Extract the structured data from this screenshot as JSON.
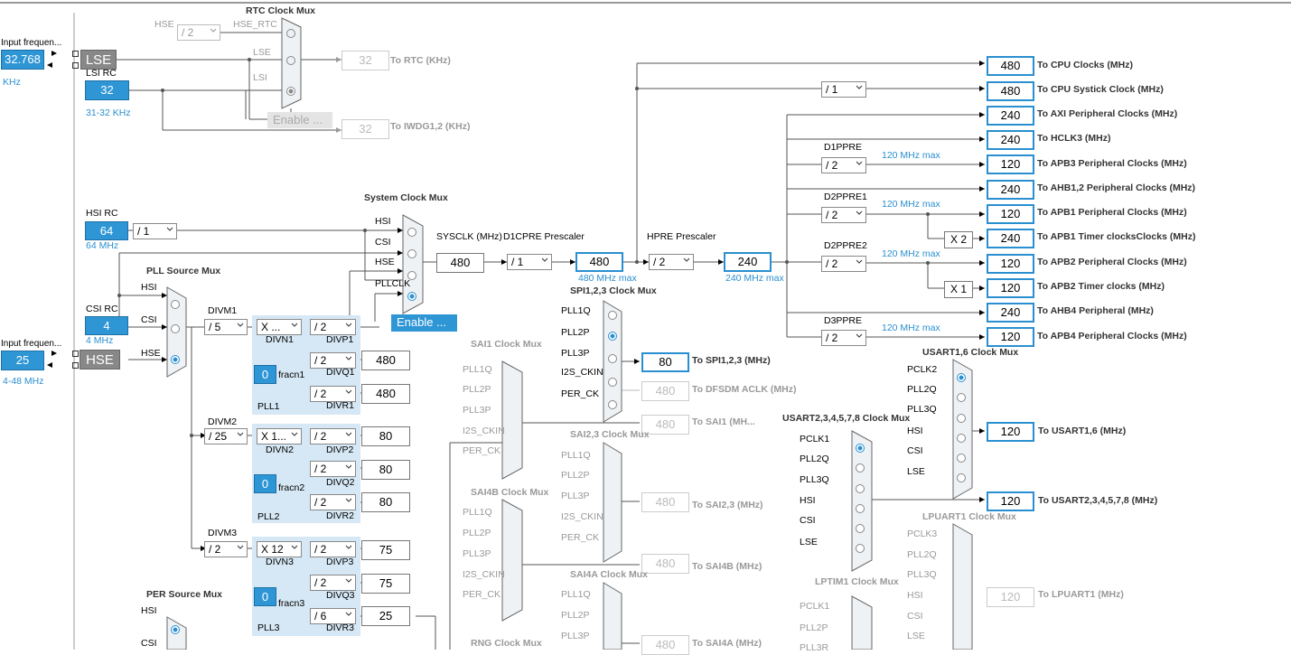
{
  "rtc": {
    "title": "RTC Clock Mux",
    "hse_label": "HSE",
    "hse_rtc_label": "HSE_RTC",
    "hse_div": "/ 2",
    "in_lse": "LSE",
    "in_lsi": "LSI",
    "out_value": "32",
    "out_label": "To RTC (KHz)",
    "enable": "Enable ...",
    "iwdg_value": "32",
    "iwdg_label": "To IWDG1,2 (KHz)"
  },
  "lse": {
    "input_label": "Input frequen...",
    "value": "32.768",
    "unit": "KHz",
    "name": "LSE"
  },
  "lsi": {
    "name": "LSI RC",
    "value": "32",
    "range": "31-32 KHz"
  },
  "hsi": {
    "name": "HSI RC",
    "value": "64",
    "freq": "64 MHz",
    "div": "/ 1"
  },
  "csi": {
    "name": "CSI RC",
    "value": "4",
    "freq": "4 MHz"
  },
  "hse": {
    "input_label": "Input frequen...",
    "value": "25",
    "range": "4-48 MHz",
    "name": "HSE"
  },
  "sysmux": {
    "title": "System Clock Mux",
    "inputs": [
      "HSI",
      "CSI",
      "HSE",
      "PLLCLK"
    ],
    "enable": "Enable ...",
    "sysclk_label": "SYSCLK (MHz)",
    "sysclk_value": "480",
    "d1cpre_label": "D1CPRE Prescaler",
    "d1cpre_div": "/ 1",
    "d1cpre_out": "480",
    "d1cpre_max": "480 MHz max",
    "hpre_label": "HPRE Prescaler",
    "hpre_div": "/ 2",
    "hpre_out": "240",
    "hpre_max": "240 MHz max",
    "systick_div": "/ 1"
  },
  "pll_src": {
    "title": "PLL Source Mux",
    "inputs": [
      "HSI",
      "CSI",
      "HSE"
    ]
  },
  "pll1": {
    "divm_label": "DIVM1",
    "divm": "/ 5",
    "divn": "X ...",
    "divn_label": "DIVN1",
    "divp": "/ 2",
    "divp_label": "DIVP1",
    "divq": "/ 2",
    "divq_label": "DIVQ1",
    "divq_out": "480",
    "divr": "/ 2",
    "divr_label": "DIVR1",
    "divr_out": "480",
    "frac": "0",
    "frac_label": "fracn1",
    "name": "PLL1"
  },
  "pll2": {
    "divm_label": "DIVM2",
    "divm": "/ 25",
    "divn": "X 1...",
    "divn_label": "DIVN2",
    "divp": "/ 2",
    "divp_label": "DIVP2",
    "divp_out": "80",
    "divq": "/ 2",
    "divq_label": "DIVQ2",
    "divq_out": "80",
    "divr": "/ 2",
    "divr_label": "DIVR2",
    "divr_out": "80",
    "frac": "0",
    "frac_label": "fracn2",
    "name": "PLL2"
  },
  "pll3": {
    "divm_label": "DIVM3",
    "divm": "/ 2",
    "divn": "X 12",
    "divn_label": "DIVN3",
    "divp": "/ 2",
    "divp_label": "DIVP3",
    "divp_out": "75",
    "divq": "/ 2",
    "divq_label": "DIVQ3",
    "divq_out": "75",
    "divr": "/ 6",
    "divr_label": "DIVR3",
    "divr_out": "25",
    "frac": "0",
    "frac_label": "fracn3",
    "name": "PLL3"
  },
  "per_src": {
    "title": "PER Source Mux",
    "inputs": [
      "HSI",
      "CSI"
    ]
  },
  "outputs": [
    {
      "value": "480",
      "label": "To CPU Clocks (MHz)"
    },
    {
      "value": "480",
      "label": "To CPU Systick Clock (MHz)"
    },
    {
      "value": "240",
      "label": "To AXI Peripheral Clocks (MHz)"
    },
    {
      "value": "240",
      "label": "To HCLK3 (MHz)"
    },
    {
      "value": "120",
      "label": "To APB3 Peripheral Clocks (MHz)"
    },
    {
      "value": "240",
      "label": "To AHB1,2 Peripheral Clocks (MHz)"
    },
    {
      "value": "120",
      "label": "To APB1 Peripheral Clocks (MHz)"
    },
    {
      "value": "240",
      "label": "To APB1 Timer clocksClocks (MHz)"
    },
    {
      "value": "120",
      "label": "To APB2 Peripheral Clocks (MHz)"
    },
    {
      "value": "120",
      "label": "To APB2 Timer clocks (MHz)"
    },
    {
      "value": "240",
      "label": "To AHB4 Peripheral (MHz)"
    },
    {
      "value": "120",
      "label": "To APB4 Peripheral Clocks (MHz)"
    }
  ],
  "prescalers": {
    "d1ppre": {
      "label": "D1PPRE",
      "div": "/ 2",
      "max": "120 MHz max"
    },
    "d2ppre1": {
      "label": "D2PPRE1",
      "div": "/ 2",
      "max": "120 MHz max",
      "mul": "X 2"
    },
    "d2ppre2": {
      "label": "D2PPRE2",
      "div": "/ 2",
      "max": "120 MHz max",
      "mul": "X 1"
    },
    "d3ppre": {
      "label": "D3PPRE",
      "div": "/ 2",
      "max": "120 MHz max"
    }
  },
  "spi123": {
    "title": "SPI1,2,3 Clock Mux",
    "inputs": [
      "PLL1Q",
      "PLL2P",
      "PLL3P",
      "I2S_CKIN",
      "PER_CK"
    ],
    "value": "80",
    "label": "To SPI1,2,3 (MHz)",
    "dfsdm_value": "480",
    "dfsdm_label": "To DFSDM ACLK (MHz)"
  },
  "sai1": {
    "title": "SAI1 Clock Mux",
    "inputs": [
      "PLL1Q",
      "PLL2P",
      "PLL3P",
      "I2S_CKIN",
      "PER_CK"
    ],
    "value": "480",
    "label": "To SAI1 (MH..."
  },
  "sai23": {
    "title": "SAI2,3 Clock Mux",
    "inputs": [
      "PLL1Q",
      "PLL2P",
      "PLL3P",
      "I2S_CKIN",
      "PER_CK"
    ],
    "value": "480",
    "label": "To SAI2,3 (MHz)"
  },
  "sai4b": {
    "title": "SAI4B Clock Mux",
    "inputs": [
      "PLL1Q",
      "PLL2P",
      "PLL3P",
      "I2S_CKIN",
      "PER_CK"
    ],
    "value": "480",
    "label": "To SAI4B (MHz)"
  },
  "sai4a": {
    "title": "SAI4A Clock Mux",
    "inputs": [
      "PLL1Q",
      "PLL2P",
      "PLL3P"
    ],
    "value": "480",
    "label": "To SAI4A (MHz)"
  },
  "rng": {
    "title": "RNG Clock Mux"
  },
  "usart16": {
    "title": "USART1,6 Clock Mux",
    "inputs": [
      "PCLK2",
      "PLL2Q",
      "PLL3Q",
      "HSI",
      "CSI",
      "LSE"
    ],
    "value": "120",
    "label": "To USART1,6 (MHz)"
  },
  "usart2345": {
    "title": "USART2,3,4,5,7,8 Clock Mux",
    "inputs": [
      "PCLK1",
      "PLL2Q",
      "PLL3Q",
      "HSI",
      "CSI",
      "LSE"
    ],
    "value": "120",
    "label": "To USART2,3,4,5,7,8 (MHz)"
  },
  "lpuart1": {
    "title": "LPUART1 Clock Mux",
    "inputs": [
      "PCLK3",
      "PLL2Q",
      "PLL3Q",
      "HSI",
      "CSI",
      "LSE"
    ],
    "value": "120",
    "label": "To LPUART1 (MHz)"
  },
  "lptim1": {
    "title": "LPTIM1 Clock Mux",
    "inputs": [
      "PCLK1",
      "PLL2P",
      "PLL3R"
    ]
  },
  "colors": {
    "accent": "#2f96d6",
    "outline": "#2a8fd0",
    "pll_bg": "#d6e8f5",
    "mux_fill": "#eef2f5"
  }
}
